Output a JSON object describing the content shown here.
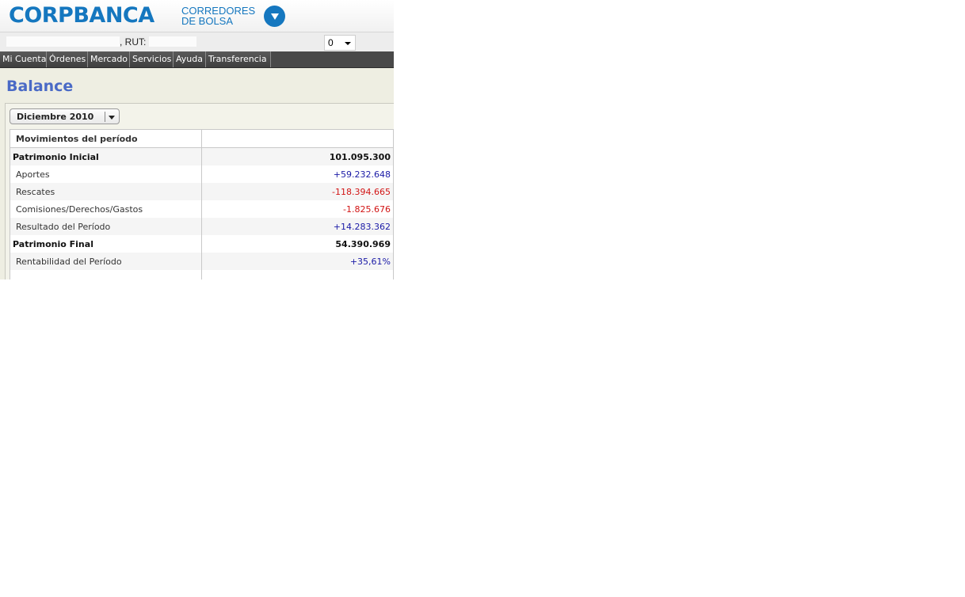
{
  "header": {
    "logo_text": "CORPBANCA",
    "logo_sub_line1": "CORREDORES",
    "logo_sub_line2": "DE BOLSA",
    "brand_color": "#1577bf",
    "menu_icon": "chevron-down-icon"
  },
  "user_bar": {
    "rut_label": ", RUT:",
    "select_value": "0"
  },
  "nav": {
    "items": [
      {
        "label": "Mi Cuenta"
      },
      {
        "label": "Órdenes"
      },
      {
        "label": "Mercado"
      },
      {
        "label": "Servicios"
      },
      {
        "label": "Ayuda"
      },
      {
        "label": "Transferencia"
      }
    ]
  },
  "page": {
    "title": "Balance",
    "title_color": "#4a6ac6",
    "period_select": "Diciembre 2010"
  },
  "table": {
    "header": "Movimientos del período",
    "rows": [
      {
        "label": "Patrimonio Inicial",
        "value": "101.095.300",
        "bold": true,
        "tone": "strong"
      },
      {
        "label": "Aportes",
        "value": "+59.232.648",
        "bold": false,
        "tone": "pos"
      },
      {
        "label": "Rescates",
        "value": "-118.394.665",
        "bold": false,
        "tone": "neg"
      },
      {
        "label": "Comisiones/Derechos/Gastos",
        "value": "-1.825.676",
        "bold": false,
        "tone": "neg"
      },
      {
        "label": "Resultado del Período",
        "value": "+14.283.362",
        "bold": false,
        "tone": "pos"
      },
      {
        "label": "Patrimonio Final",
        "value": "54.390.969",
        "bold": true,
        "tone": "strong"
      },
      {
        "label": "Rentabilidad del Período",
        "value": "+35,61%",
        "bold": false,
        "tone": "pos"
      }
    ],
    "positive_color": "#1a1aa6",
    "negative_color": "#d21414"
  }
}
